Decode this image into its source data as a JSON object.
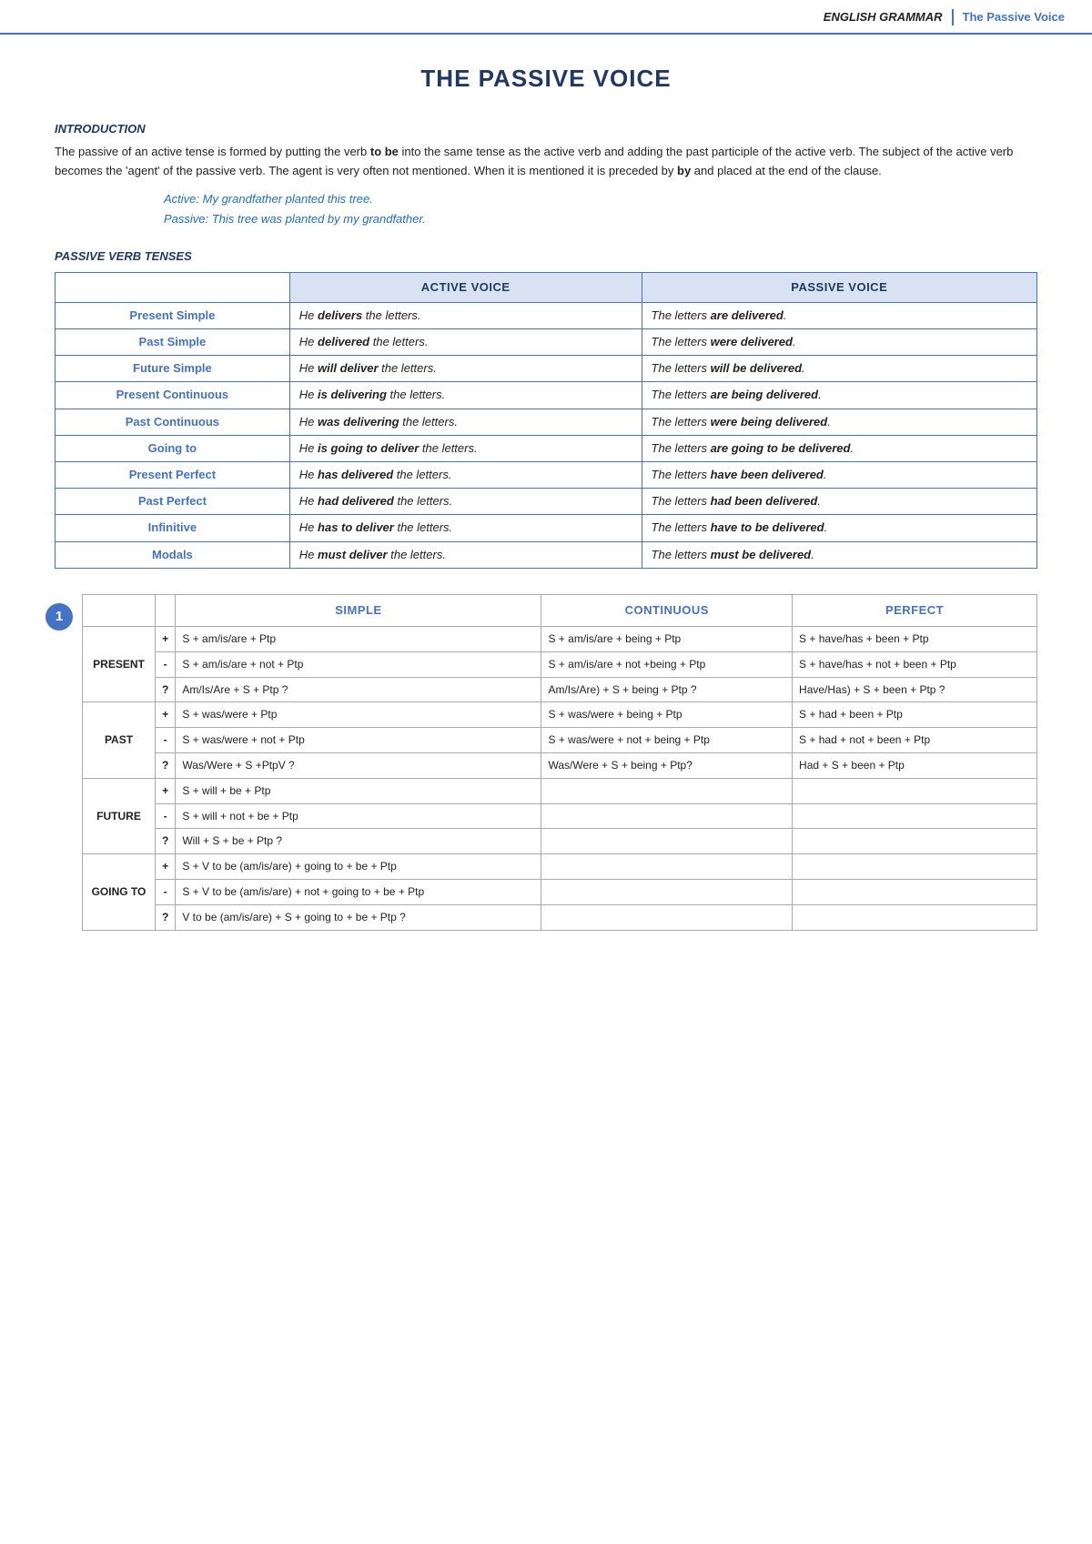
{
  "header": {
    "grammar_label": "ENGLISH GRAMMAR",
    "passive_label": "The Passive Voice"
  },
  "title": "THE PASSIVE VOICE",
  "intro": {
    "heading": "INTRODUCTION",
    "paragraph": "The passive of an active tense is formed by putting the verb to be into the same tense as the active verb and adding the past participle of the active verb. The subject of the active verb becomes the 'agent' of the passive verb. The agent is very often not mentioned. When it is mentioned it is preceded by by and placed at the end of the clause.",
    "active_example": "Active: My grandfather planted this tree.",
    "passive_example": "Passive: This tree was planted by my grandfather."
  },
  "verb_tenses_heading": "PASSIVE VERB TENSES",
  "tenses_table": {
    "headers": [
      "",
      "ACTIVE VOICE",
      "PASSIVE VOICE"
    ],
    "rows": [
      {
        "tense": "Present Simple",
        "active": "He delivers the letters.",
        "passive": "The letters are delivered.",
        "active_bold": "delivers",
        "passive_bold": "are delivered"
      },
      {
        "tense": "Past Simple",
        "active": "He delivered the letters.",
        "passive": "The letters were delivered.",
        "active_bold": "delivered",
        "passive_bold": "were delivered"
      },
      {
        "tense": "Future Simple",
        "active": "He will deliver the letters.",
        "passive": "The letters will be delivered.",
        "active_bold": "will deliver",
        "passive_bold": "will be delivered"
      },
      {
        "tense": "Present Continuous",
        "active": "He is delivering the letters.",
        "passive": "The letters are being delivered.",
        "active_bold": "is delivering",
        "passive_bold": "are being delivered"
      },
      {
        "tense": "Past Continuous",
        "active": "He was delivering the letters.",
        "passive": "The letters were being delivered.",
        "active_bold": "was delivering",
        "passive_bold": "were being delivered"
      },
      {
        "tense": "Going to",
        "active": "He is going to deliver the letters.",
        "passive": "The letters are going to be delivered.",
        "active_bold": "is going to deliver",
        "passive_bold": "are going to be delivered"
      },
      {
        "tense": "Present Perfect",
        "active": "He has delivered the letters.",
        "passive": "The letters have been delivered.",
        "active_bold": "has delivered",
        "passive_bold": "have been delivered"
      },
      {
        "tense": "Past Perfect",
        "active": "He had delivered the letters.",
        "passive": "The letters had been delivered.",
        "active_bold": "had delivered",
        "passive_bold": "had been delivered"
      },
      {
        "tense": "Infinitive",
        "active": "He has to deliver the letters.",
        "passive": "The letters have to be delivered.",
        "active_bold": "has to deliver",
        "passive_bold": "have to be delivered"
      },
      {
        "tense": "Modals",
        "active": "He must deliver the letters.",
        "passive": "The letters must be delivered.",
        "active_bold": "must deliver",
        "passive_bold": "must be delivered"
      }
    ]
  },
  "formula_table": {
    "badge": "1",
    "headers": [
      "",
      "",
      "SIMPLE",
      "CONTINUOUS",
      "PERFECT"
    ],
    "sections": [
      {
        "label": "PRESENT",
        "rows": [
          {
            "sign": "+",
            "simple": "S + am/is/are + Ptp",
            "continuous": "S + am/is/are + being + Ptp",
            "perfect": "S + have/has + been + Ptp"
          },
          {
            "sign": "-",
            "simple": "S + am/is/are +  not + Ptp",
            "continuous": "S + am/is/are + not +being + Ptp",
            "perfect": "S + have/has + not + been + Ptp"
          },
          {
            "sign": "?",
            "simple": "Am/Is/Are + S + Ptp ?",
            "continuous": "Am/Is/Are) + S + being + Ptp ?",
            "perfect": "Have/Has) + S + been + Ptp ?"
          }
        ]
      },
      {
        "label": "PAST",
        "rows": [
          {
            "sign": "+",
            "simple": "S + was/were + Ptp",
            "continuous": "S + was/were + being + Ptp",
            "perfect": "S + had + been + Ptp"
          },
          {
            "sign": "-",
            "simple": "S + was/were + not + Ptp",
            "continuous": "S + was/were + not + being + Ptp",
            "perfect": "S + had + not + been + Ptp"
          },
          {
            "sign": "?",
            "simple": "Was/Were + S +PtpV ?",
            "continuous": "Was/Were + S + being + Ptp?",
            "perfect": "Had + S + been + Ptp"
          }
        ]
      },
      {
        "label": "FUTURE",
        "rows": [
          {
            "sign": "+",
            "simple": "S + will + be + Ptp",
            "continuous": "",
            "perfect": ""
          },
          {
            "sign": "-",
            "simple": "S + will + not + be + Ptp",
            "continuous": "",
            "perfect": ""
          },
          {
            "sign": "?",
            "simple": "Will + S + be + Ptp ?",
            "continuous": "",
            "perfect": ""
          }
        ]
      },
      {
        "label": "GOING TO",
        "rows": [
          {
            "sign": "+",
            "simple": "S + V to be (am/is/are) + going to + be + Ptp",
            "continuous": "",
            "perfect": ""
          },
          {
            "sign": "-",
            "simple": "S + V to be (am/is/are) + not + going to + be + Ptp",
            "continuous": "",
            "perfect": ""
          },
          {
            "sign": "?",
            "simple": "V to be (am/is/are) + S + going to + be + Ptp ?",
            "continuous": "",
            "perfect": ""
          }
        ]
      }
    ]
  }
}
